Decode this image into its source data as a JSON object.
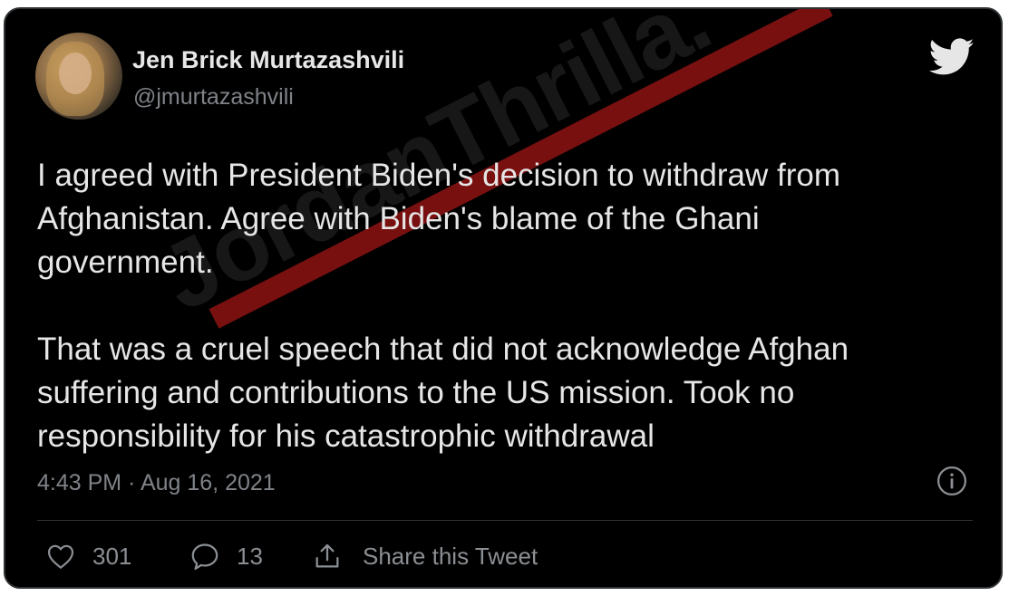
{
  "tweet": {
    "author": {
      "display_name": "Jen Brick Murtazashvili",
      "handle": "@jmurtazashvili",
      "avatar_icon": "profile-photo"
    },
    "text_paragraph_1_lines": [
      "I agreed with President Biden's decision to withdraw from",
      "Afghanistan. Agree with Biden's blame of the Ghani",
      "government."
    ],
    "text_paragraph_2_lines": [
      "That was a cruel speech that did not acknowledge Afghan",
      "suffering and contributions to the US mission. Took no",
      "responsibility for his catastrophic withdrawal"
    ],
    "timestamp": "4:43 PM · Aug 16, 2021",
    "actions": {
      "like_count": "301",
      "reply_count": "13",
      "share_label": "Share this Tweet"
    }
  },
  "watermark": {
    "text": "JordanThrilla."
  },
  "icons": {
    "brand": "twitter-bird-icon",
    "info": "info-icon",
    "like": "heart-icon",
    "reply": "reply-icon",
    "share": "share-icon"
  },
  "colors": {
    "background": "#000000",
    "text": "#e6e6e6",
    "muted": "#7f8388",
    "twitter_logo": "#e6e6e6"
  }
}
